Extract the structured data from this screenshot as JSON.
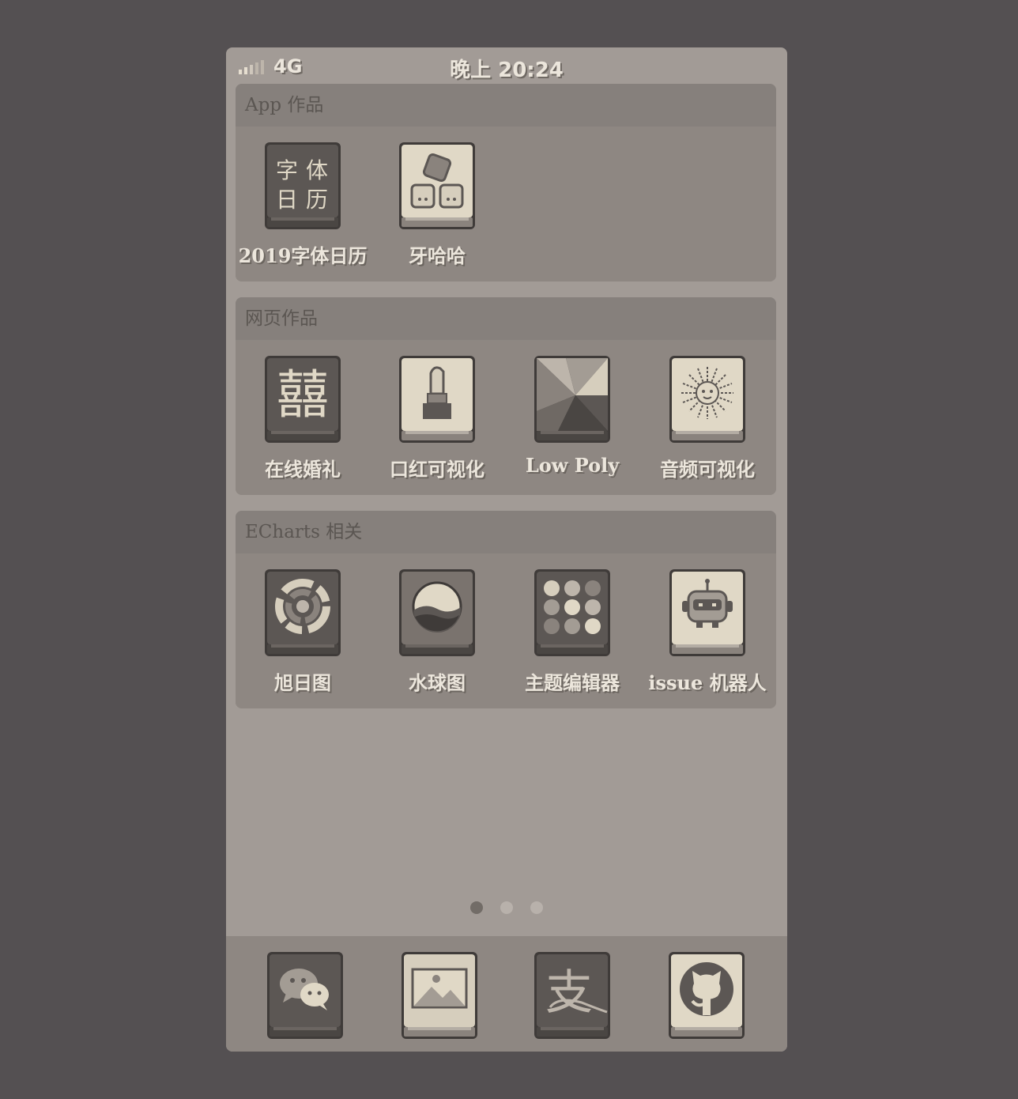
{
  "status_bar": {
    "network": "4G",
    "time": "晚上 20:24"
  },
  "groups": [
    {
      "title": "App 作品",
      "apps": [
        {
          "label": "2019字体日历",
          "icon": "font-calendar-icon",
          "glyphs": [
            "字",
            "体",
            "日",
            "历"
          ]
        },
        {
          "label": "牙哈哈",
          "icon": "dice-icon"
        }
      ]
    },
    {
      "title": "网页作品",
      "apps": [
        {
          "label": "在线婚礼",
          "icon": "double-happiness-icon",
          "glyph": "囍"
        },
        {
          "label": "口红可视化",
          "icon": "lipstick-icon"
        },
        {
          "label": "Low Poly",
          "icon": "low-poly-icon"
        },
        {
          "label": "音频可视化",
          "icon": "sun-burst-icon"
        }
      ]
    },
    {
      "title": "ECharts 相关",
      "apps": [
        {
          "label": "旭日图",
          "icon": "sunburst-chart-icon"
        },
        {
          "label": "水球图",
          "icon": "liquid-ball-icon"
        },
        {
          "label": "主题编辑器",
          "icon": "palette-grid-icon"
        },
        {
          "label": "issue 机器人",
          "icon": "robot-icon"
        }
      ]
    }
  ],
  "pagination": {
    "pages": 3,
    "current": 1
  },
  "dock": [
    {
      "icon": "wechat-icon"
    },
    {
      "icon": "photos-icon"
    },
    {
      "icon": "alipay-icon",
      "glyph": "支"
    },
    {
      "icon": "github-icon"
    }
  ],
  "colors": {
    "background": "#545052",
    "phone": "#a29b96",
    "dark_tile": "#5c5754",
    "light_tile": "#e0d8c6",
    "label": "#ece6dc"
  }
}
